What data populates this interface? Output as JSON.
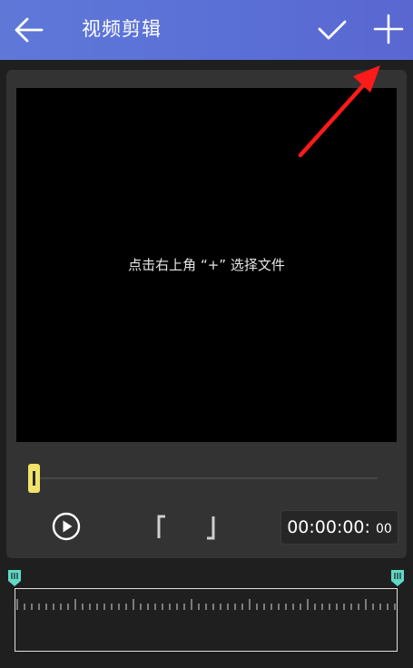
{
  "header": {
    "title": "视频剪辑",
    "back_icon": "arrow-left-icon",
    "confirm_icon": "check-icon",
    "add_icon": "plus-icon",
    "background": "#5a6fd6"
  },
  "preview": {
    "hint": "点击右上角 “+” 选择文件"
  },
  "player": {
    "time_main": "00:00:00:",
    "time_frames": "00",
    "play_icon": "play-icon",
    "handle_color": "#f2e36a",
    "position_fraction": 0
  },
  "timeline": {
    "marker_color": "#5fd9c4"
  },
  "annotation": {
    "arrow_color": "#ff1a1a"
  }
}
